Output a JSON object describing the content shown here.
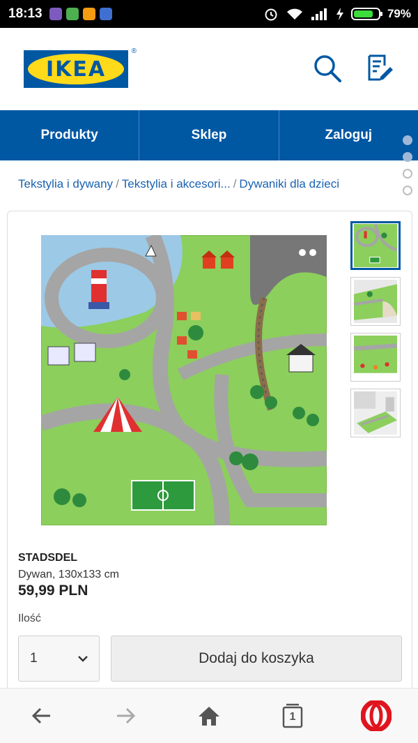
{
  "status_bar": {
    "time": "18:13",
    "battery_percent": "79%",
    "battery_level": 0.79
  },
  "header": {
    "logo_text": "IKEA",
    "logo_reg": "®",
    "icons": [
      "search-icon",
      "shopping-list-icon"
    ]
  },
  "nav": {
    "tabs": [
      {
        "label": "Produkty"
      },
      {
        "label": "Sklep"
      },
      {
        "label": "Zaloguj"
      }
    ]
  },
  "breadcrumb": {
    "items": [
      "Tekstylia i dywany",
      "Tekstylia i akcesori...",
      "Dywaniki dla dzieci"
    ],
    "separator": "/"
  },
  "product": {
    "name": "STADSDEL",
    "description": "Dywan, 130x133 cm",
    "price": "59,99 PLN",
    "quantity_label": "Ilość",
    "quantity_value": "1",
    "add_to_cart_label": "Dodaj do koszyka"
  },
  "bottom_bar": {
    "tabs_count": "1",
    "icons": [
      "back-arrow-icon",
      "forward-arrow-icon",
      "home-icon",
      "tabs-icon",
      "opera-logo-icon"
    ]
  },
  "colors": {
    "ikea_blue": "#0058a3",
    "ikea_yellow": "#ffda1a",
    "link_blue": "#1a62b0",
    "opera_red": "#e0141e"
  }
}
